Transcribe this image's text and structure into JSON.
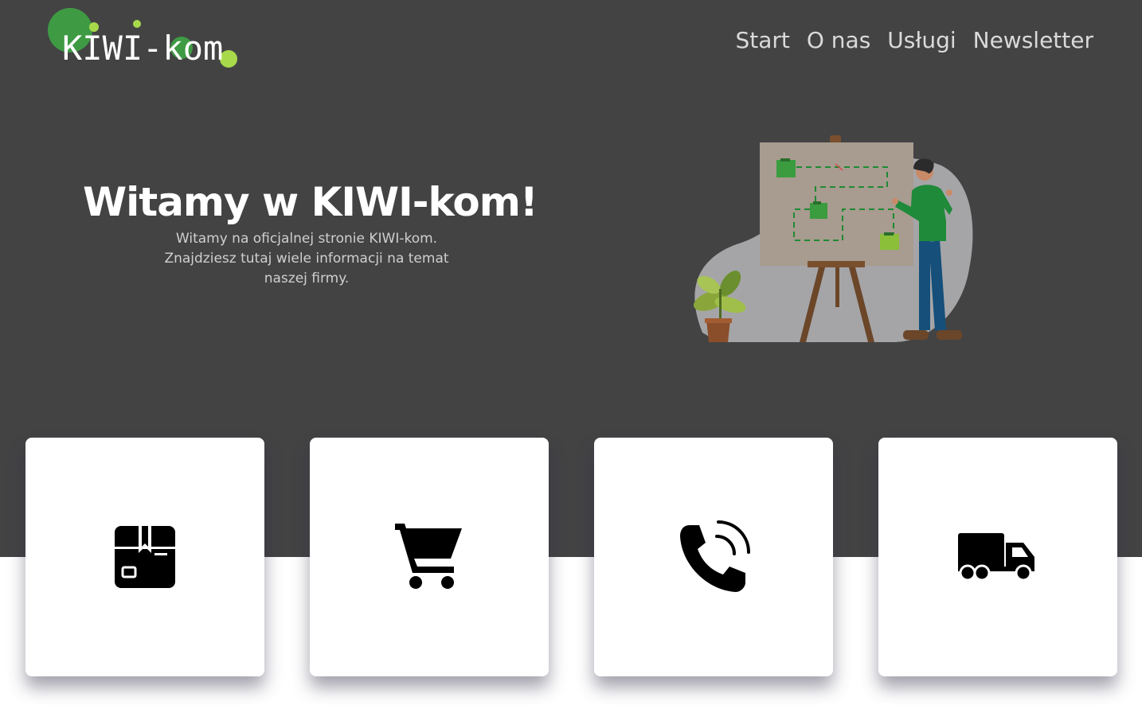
{
  "brand": {
    "logo_text": "KIWI-kom"
  },
  "nav": {
    "items": [
      "Start",
      "O nas",
      "Usługi",
      "Newsletter"
    ]
  },
  "hero": {
    "title": "Witamy w KIWI-kom!",
    "subtitle": "Witamy na oficjalnej stronie KIWI-kom. Znajdziesz tutaj wiele informacji na temat naszej firmy."
  },
  "cards": [
    {
      "icon": "package-icon"
    },
    {
      "icon": "shopping-cart-icon"
    },
    {
      "icon": "phone-call-icon"
    },
    {
      "icon": "delivery-truck-icon"
    }
  ],
  "colors": {
    "header_bg": "#434344",
    "page_bg": "#ffffff",
    "brand_green": "#3a9a45",
    "brand_lime": "#a8d94a",
    "nav_text": "#dadada"
  }
}
